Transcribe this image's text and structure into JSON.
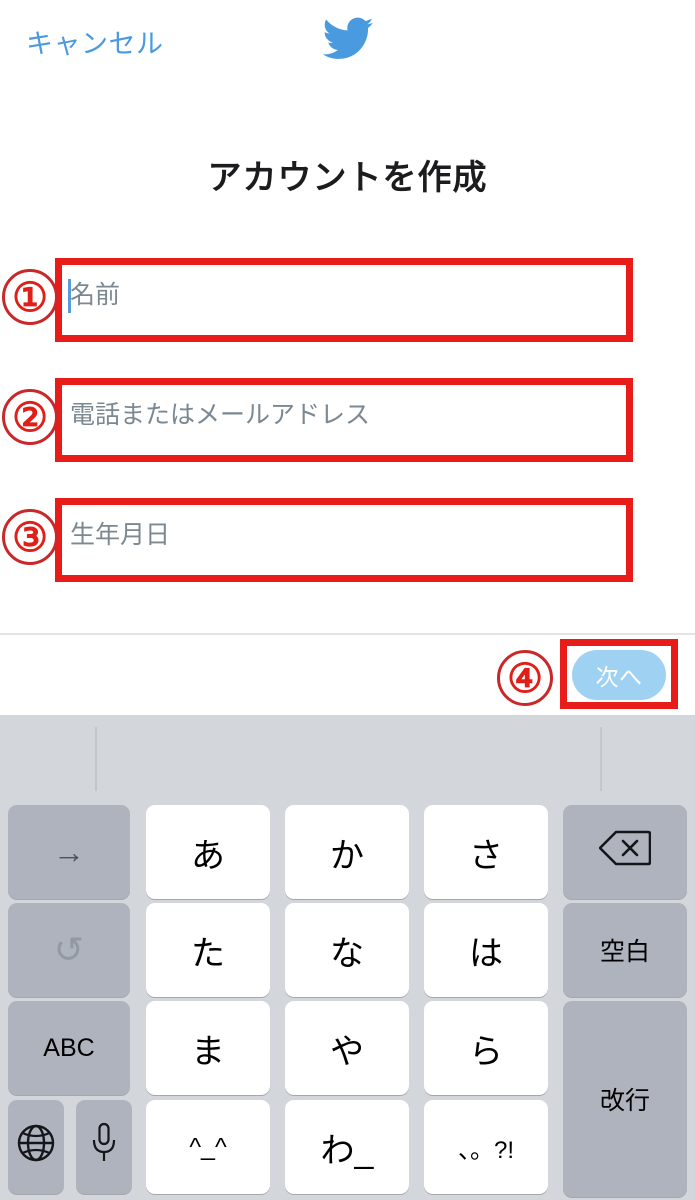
{
  "app": {
    "name": "Twitter",
    "accent_blue": "#4a9ae0",
    "annotation_red": "#e81d19"
  },
  "navbar": {
    "cancel_label": "キャンセル",
    "logo_icon": "twitter-bird-icon"
  },
  "title": "アカウントを作成",
  "form": {
    "fields": [
      {
        "placeholder": "名前",
        "value": "",
        "focused": true,
        "annotation": "①"
      },
      {
        "placeholder": "電話またはメールアドレス",
        "value": "",
        "focused": false,
        "annotation": "②"
      },
      {
        "placeholder": "生年月日",
        "value": "",
        "focused": false,
        "annotation": "③"
      }
    ]
  },
  "action_bar": {
    "next_label": "次へ",
    "next_enabled": false,
    "next_bg": "#9fd2f2",
    "annotation": "④"
  },
  "keyboard": {
    "type": "japanese-kana-12key",
    "toolbar": {
      "left_divider": true,
      "right_divider": true
    },
    "rows": [
      {
        "keys": [
          {
            "label": "→",
            "icon": "arrow-right-icon",
            "style": "gray"
          },
          {
            "label": "あ",
            "icon": "",
            "style": "white"
          },
          {
            "label": "か",
            "icon": "",
            "style": "white"
          },
          {
            "label": "さ",
            "icon": "",
            "style": "white"
          },
          {
            "label": "",
            "icon": "backspace-icon",
            "style": "gray"
          }
        ]
      },
      {
        "keys": [
          {
            "label": "↺",
            "icon": "undo-icon",
            "style": "gray"
          },
          {
            "label": "た",
            "icon": "",
            "style": "white"
          },
          {
            "label": "な",
            "icon": "",
            "style": "white"
          },
          {
            "label": "は",
            "icon": "",
            "style": "white"
          },
          {
            "label": "空白",
            "icon": "",
            "style": "gray"
          }
        ]
      },
      {
        "keys": [
          {
            "label": "ABC",
            "icon": "",
            "style": "gray"
          },
          {
            "label": "ま",
            "icon": "",
            "style": "white"
          },
          {
            "label": "や",
            "icon": "",
            "style": "white"
          },
          {
            "label": "ら",
            "icon": "",
            "style": "white"
          },
          {
            "label": "改行",
            "icon": "",
            "style": "gray"
          }
        ]
      },
      {
        "keys": [
          {
            "label": "",
            "icon": "globe-icon",
            "style": "gray"
          },
          {
            "label": "",
            "icon": "microphone-icon",
            "style": "gray"
          },
          {
            "label": "^_^",
            "icon": "",
            "style": "white"
          },
          {
            "label": "わ_",
            "icon": "",
            "style": "white"
          },
          {
            "label": "、。?!",
            "icon": "",
            "style": "white"
          }
        ]
      }
    ]
  }
}
